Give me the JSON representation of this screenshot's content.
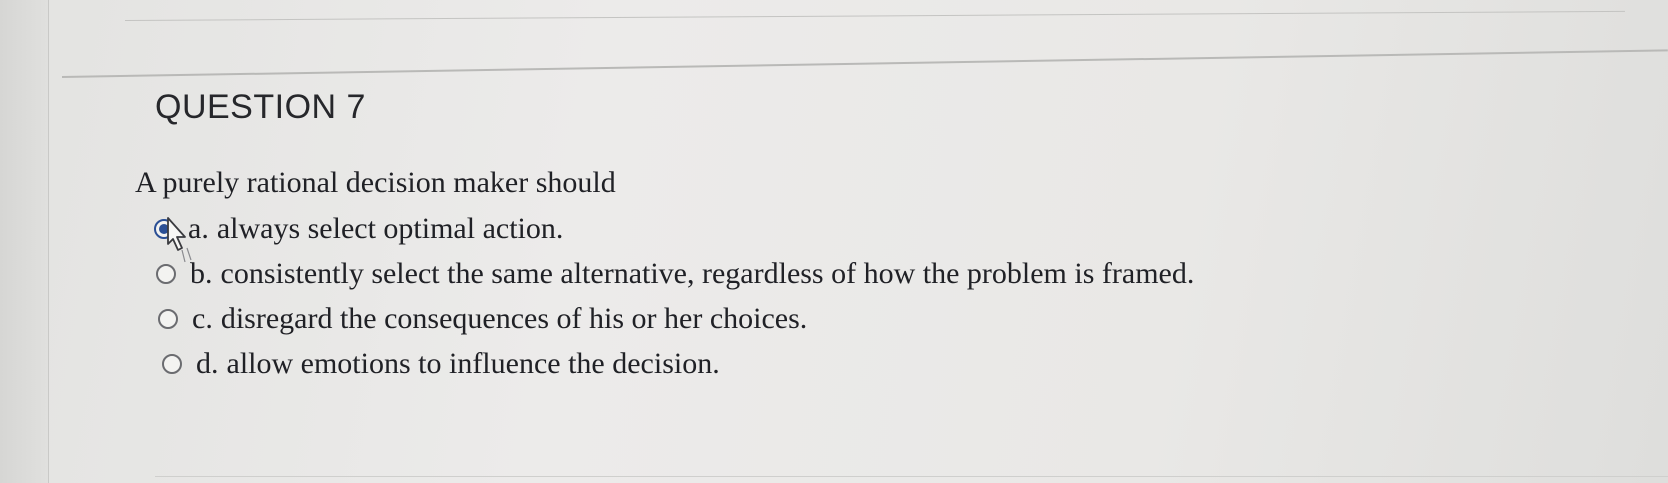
{
  "question": {
    "heading": "QUESTION 7",
    "prompt": "A purely rational decision maker should",
    "options": [
      {
        "letter": "a.",
        "text": "always select optimal action.",
        "selected": true
      },
      {
        "letter": "b.",
        "text": "consistently select the same alternative, regardless of how the problem is framed.",
        "selected": false
      },
      {
        "letter": "c.",
        "text": "disregard the consequences of his or her choices.",
        "selected": false
      },
      {
        "letter": "d.",
        "text": "allow emotions to influence the decision.",
        "selected": false
      }
    ]
  },
  "icons": {
    "radio_selected": "radio-selected-icon",
    "radio_unselected": "radio-unselected-icon",
    "cursor": "hand-pointer-cursor"
  },
  "colors": {
    "selected_radio": "#2a4f95",
    "text": "#202126",
    "background": "#e9e8e6"
  }
}
